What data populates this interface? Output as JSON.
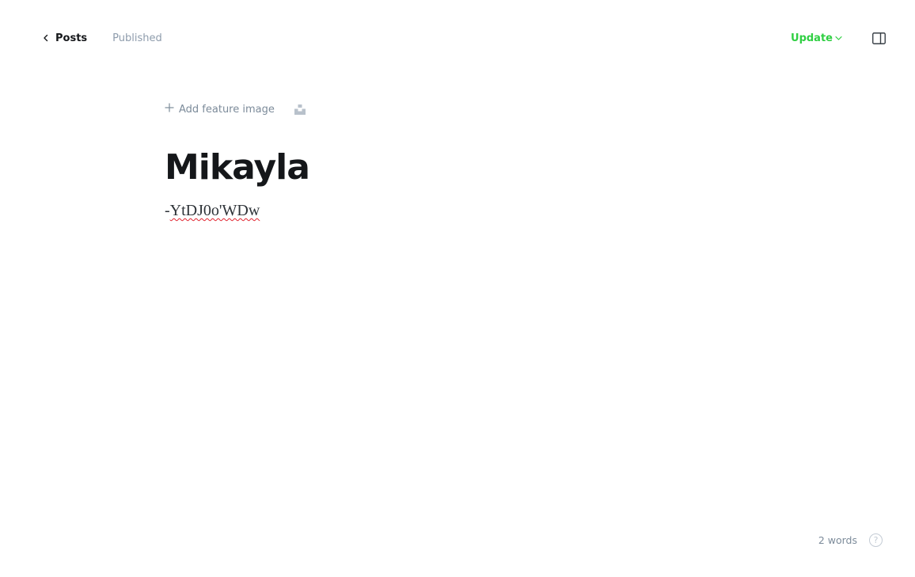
{
  "header": {
    "back_label": "Posts",
    "status": "Published",
    "update_label": "Update",
    "icons": {
      "back": "chevron-left-icon",
      "update_dropdown": "chevron-down-icon",
      "settings": "sidebar-toggle-icon"
    },
    "colors": {
      "update": "#30cf43",
      "status": "#8e9cac"
    }
  },
  "editor": {
    "feature_image_label": "Add feature image",
    "title": "Mikayla",
    "body_prefix": "-",
    "body_misspelled": "YtDJ0o'WDw",
    "icons": {
      "add": "plus-icon",
      "unsplash": "unsplash-icon"
    }
  },
  "footer": {
    "word_count": "2 words",
    "help_symbol": "?"
  }
}
